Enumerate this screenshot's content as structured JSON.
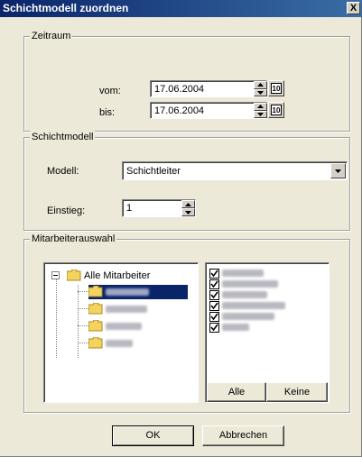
{
  "window": {
    "title": "Schichtmodell zuordnen",
    "close_label": "X"
  },
  "zeitraum": {
    "legend": "Zeitraum",
    "vom_label": "vom:",
    "vom_value": "17.06.2004",
    "bis_label": "bis:",
    "bis_value": "17.06.2004",
    "calendar_icon_text": "10"
  },
  "schichtmodell": {
    "legend": "Schichtmodell",
    "modell_label": "Modell:",
    "modell_value": "Schichtleiter",
    "einstieg_label": "Einstieg:",
    "einstieg_value": "1"
  },
  "mitarbeiter": {
    "legend": "Mitarbeiterauswahl",
    "tree_root": "Alle Mitarbeiter",
    "tree_child_count": 4,
    "checked_count": 6,
    "alle_button": "Alle",
    "keine_button": "Keine"
  },
  "buttons": {
    "ok": "OK",
    "cancel": "Abbrechen"
  },
  "icons": {
    "close": "close-icon",
    "spin_up": "spin-up-arrow-icon",
    "spin_down": "spin-down-arrow-icon",
    "calendar": "calendar-icon",
    "dropdown": "dropdown-arrow-icon",
    "folder": "folder-icon",
    "tree_toggle": "tree-collapse-icon",
    "checkbox": "checkbox-checked-icon"
  }
}
